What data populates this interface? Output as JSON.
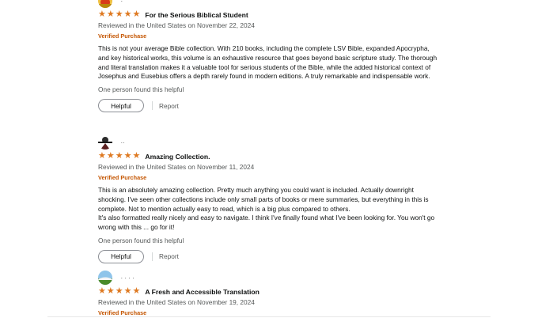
{
  "reviews": [
    {
      "reviewer": "·",
      "rating": 5,
      "title": "For the Serious Biblical Student",
      "meta": "Reviewed in the United States on November 22, 2024",
      "verified": "Verified Purchase",
      "body": [
        "This is not your average Bible collection. With 210 books, including the complete LSV Bible, expanded Apocrypha, and key historical works, this volume is an exhaustive resource that goes beyond basic scripture study. The thorough and literal translation makes it a valuable tool for serious students of the Bible, while the added historical context of Josephus and Eusebius offers a depth rarely found in modern editions. A truly remarkable and indispensable work."
      ],
      "helpful_count": "One person found this helpful",
      "helpful_label": "Helpful",
      "report_label": "Report"
    },
    {
      "reviewer": "··",
      "rating": 5,
      "title": "Amazing Collection.",
      "meta": "Reviewed in the United States on November 11, 2024",
      "verified": "Verified Purchase",
      "body": [
        "This is an absolutely amazing collection. Pretty much anything you could want is included. Actually downright shocking. I've seen other collections include only small parts of books or mere summaries, but everything in this is complete. Not to mention actually easy to read, which is a big plus compared to others.",
        "It's also formatted really nicely and easy to navigate. I think I've finally found what I've been looking for. You won't go wrong with this ... go for it!"
      ],
      "helpful_count": "One person found this helpful",
      "helpful_label": "Helpful",
      "report_label": "Report"
    },
    {
      "reviewer": "· · · ·",
      "rating": 5,
      "title": "A Fresh and Accessible Translation",
      "meta": "Reviewed in the United States on November 19, 2024",
      "verified": "Verified Purchase"
    }
  ],
  "colors": {
    "star": "#de7921",
    "verified": "#c45500",
    "meta": "#565959"
  },
  "icons": {
    "star": "star-icon",
    "avatar": "avatar"
  }
}
